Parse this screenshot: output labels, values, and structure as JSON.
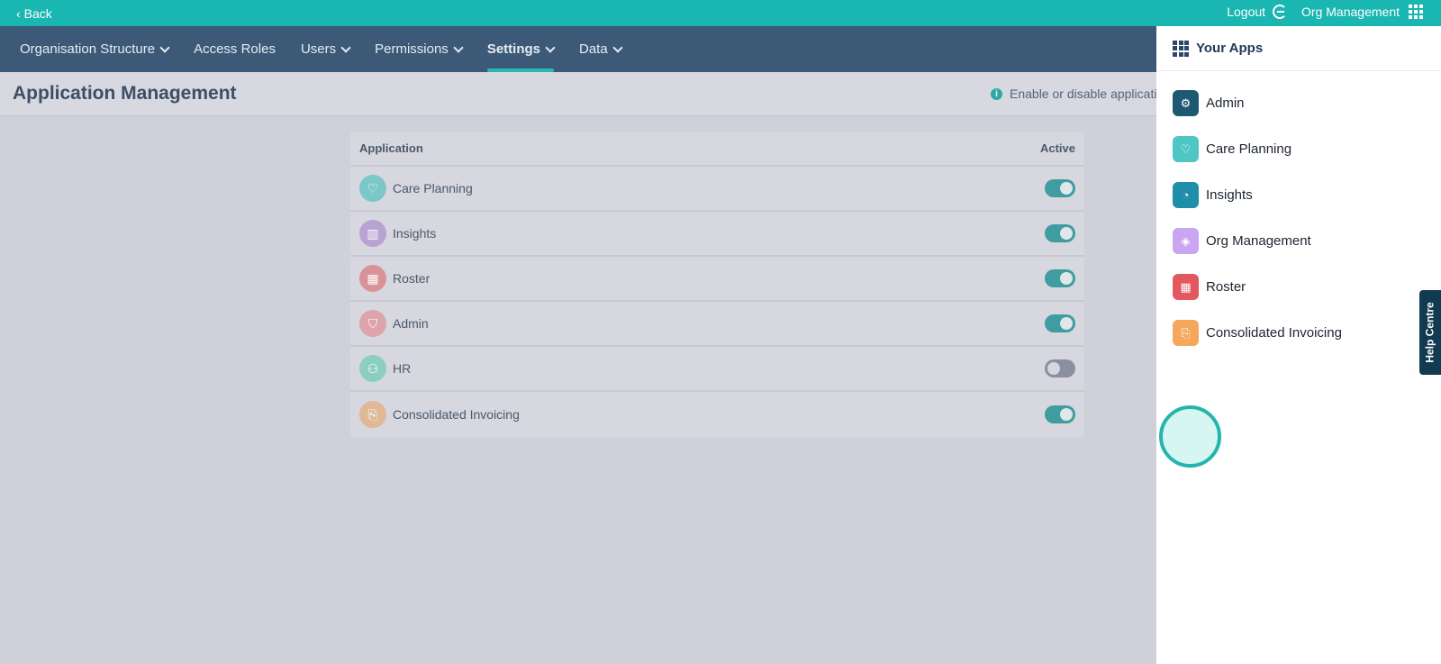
{
  "topbar": {
    "back_label": "Back",
    "logout_label": "Logout",
    "app_name": "Org Management"
  },
  "nav": {
    "items": [
      {
        "label": "Organisation Structure",
        "has_menu": true,
        "active": false
      },
      {
        "label": "Access Roles",
        "has_menu": false,
        "active": false
      },
      {
        "label": "Users",
        "has_menu": true,
        "active": false
      },
      {
        "label": "Permissions",
        "has_menu": true,
        "active": false
      },
      {
        "label": "Settings",
        "has_menu": true,
        "active": true
      },
      {
        "label": "Data",
        "has_menu": true,
        "active": false
      }
    ]
  },
  "page": {
    "title": "Application Management",
    "info_text": "Enable or disable applicati"
  },
  "table": {
    "col_application": "Application",
    "col_active": "Active",
    "rows": [
      {
        "name": "Care Planning",
        "icon": "heart-icon",
        "color": "#7cc7c9",
        "active": true
      },
      {
        "name": "Insights",
        "icon": "bar-chart-icon",
        "color": "#b9a3d3",
        "active": true
      },
      {
        "name": "Roster",
        "icon": "calendar-icon",
        "color": "#d99398",
        "active": true
      },
      {
        "name": "Admin",
        "icon": "shield-icon",
        "color": "#dea4ab",
        "active": true
      },
      {
        "name": "HR",
        "icon": "people-icon",
        "color": "#8ccfbf",
        "active": false
      },
      {
        "name": "Consolidated Invoicing",
        "icon": "invoice-icon",
        "color": "#e0b797",
        "active": true
      }
    ]
  },
  "drawer": {
    "title": "Your Apps",
    "apps": [
      {
        "name": "Admin",
        "icon": "gear-icon",
        "color": "#1d5a72"
      },
      {
        "name": "Care Planning",
        "icon": "heart-icon",
        "color": "#4fc6c3"
      },
      {
        "name": "Insights",
        "icon": "pie-chart-icon",
        "color": "#1f8ea8"
      },
      {
        "name": "Org Management",
        "icon": "layers-icon",
        "color": "#c9a6ef"
      },
      {
        "name": "Roster",
        "icon": "calendar-icon",
        "color": "#e3585f"
      },
      {
        "name": "Consolidated Invoicing",
        "icon": "invoice-icon",
        "color": "#f5a85c"
      }
    ]
  },
  "help_label": "Help Centre"
}
